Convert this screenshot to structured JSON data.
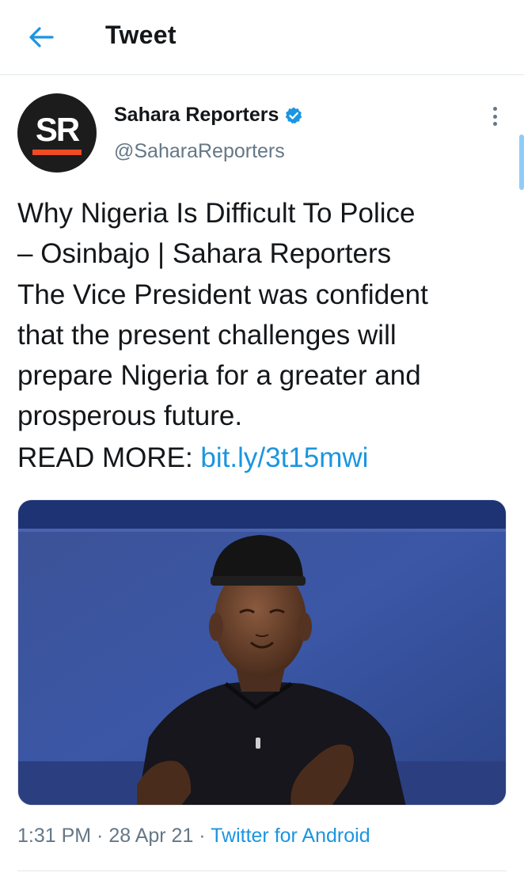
{
  "header": {
    "title": "Tweet",
    "back_icon": "arrow-left-icon"
  },
  "author": {
    "avatar_text": "SR",
    "display_name": "Sahara Reporters",
    "handle": "@SaharaReporters",
    "verified": true
  },
  "tweet": {
    "text": "Why Nigeria Is Difficult To Police\n– Osinbajo | Sahara Reporters\nThe Vice President was confident\nthat the present challenges will\nprepare Nigeria for a greater and\nprosperous future.",
    "read_more_label": "READ MORE: ",
    "link": "bit.ly/3t15mwi"
  },
  "meta": {
    "time": "1:31 PM",
    "separator": " · ",
    "date": "28 Apr 21",
    "source": "Twitter for Android"
  },
  "colors": {
    "accent": "#1b95e0",
    "secondary_text": "#657786",
    "brand_orange": "#f04b23"
  }
}
